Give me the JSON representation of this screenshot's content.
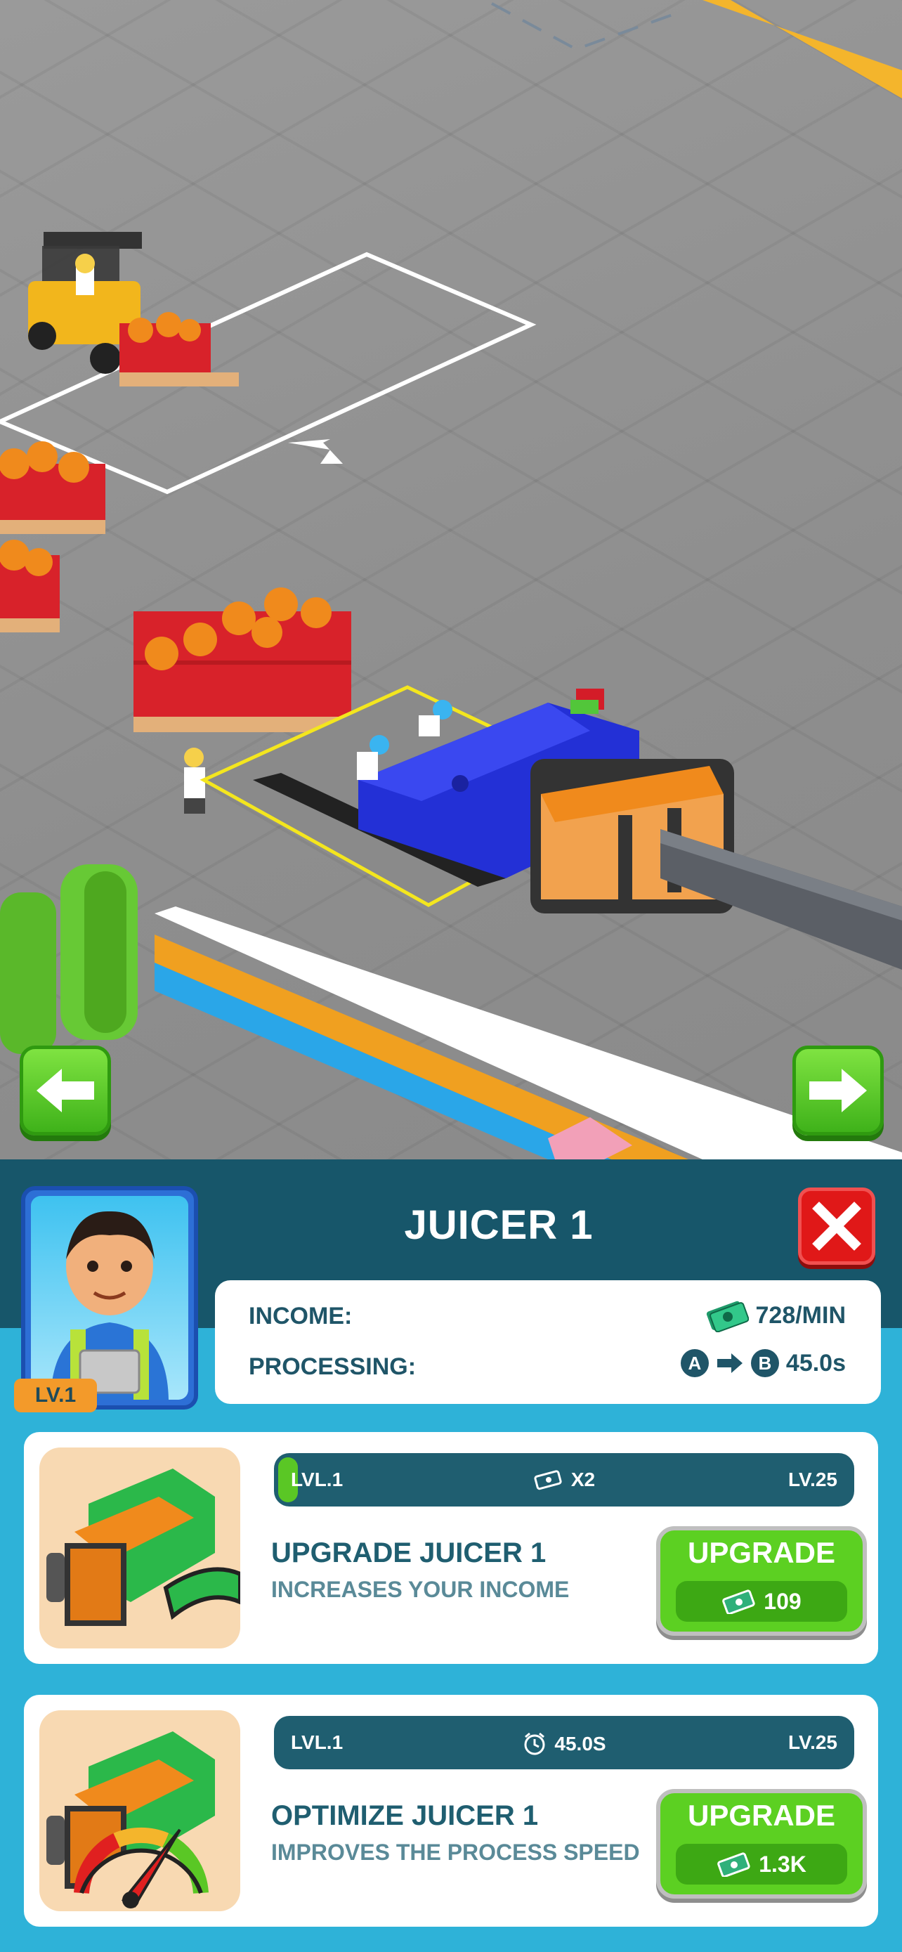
{
  "panel": {
    "title": "JUICER 1",
    "level_badge": "LV.1",
    "income_label": "INCOME:",
    "income_value": "728/MIN",
    "processing_label": "PROCESSING:",
    "processing_from": "A",
    "processing_to": "B",
    "processing_time": "45.0s",
    "close_label": "X"
  },
  "upgrades": [
    {
      "level_current": "LVL.1",
      "effect": "X2",
      "effect_icon": "cash-icon",
      "level_max": "LV.25",
      "progress": 0.03,
      "title": "UPGRADE JUICER 1",
      "subtitle": "INCREASES YOUR INCOME",
      "button_label": "UPGRADE",
      "cost": "109"
    },
    {
      "level_current": "LVL.1",
      "effect": "45.0S",
      "effect_icon": "alarm-clock-icon",
      "level_max": "LV.25",
      "progress": 0.0,
      "title": "OPTIMIZE JUICER 1",
      "subtitle": "IMPROVES THE PROCESS SPEED",
      "button_label": "UPGRADE",
      "cost": "1.3K"
    }
  ],
  "colors": {
    "header": "#17566a",
    "panel_bg": "#2eb2d8",
    "button_green": "#5cd022",
    "close_red": "#e01818",
    "badge_orange": "#f39a2a"
  }
}
